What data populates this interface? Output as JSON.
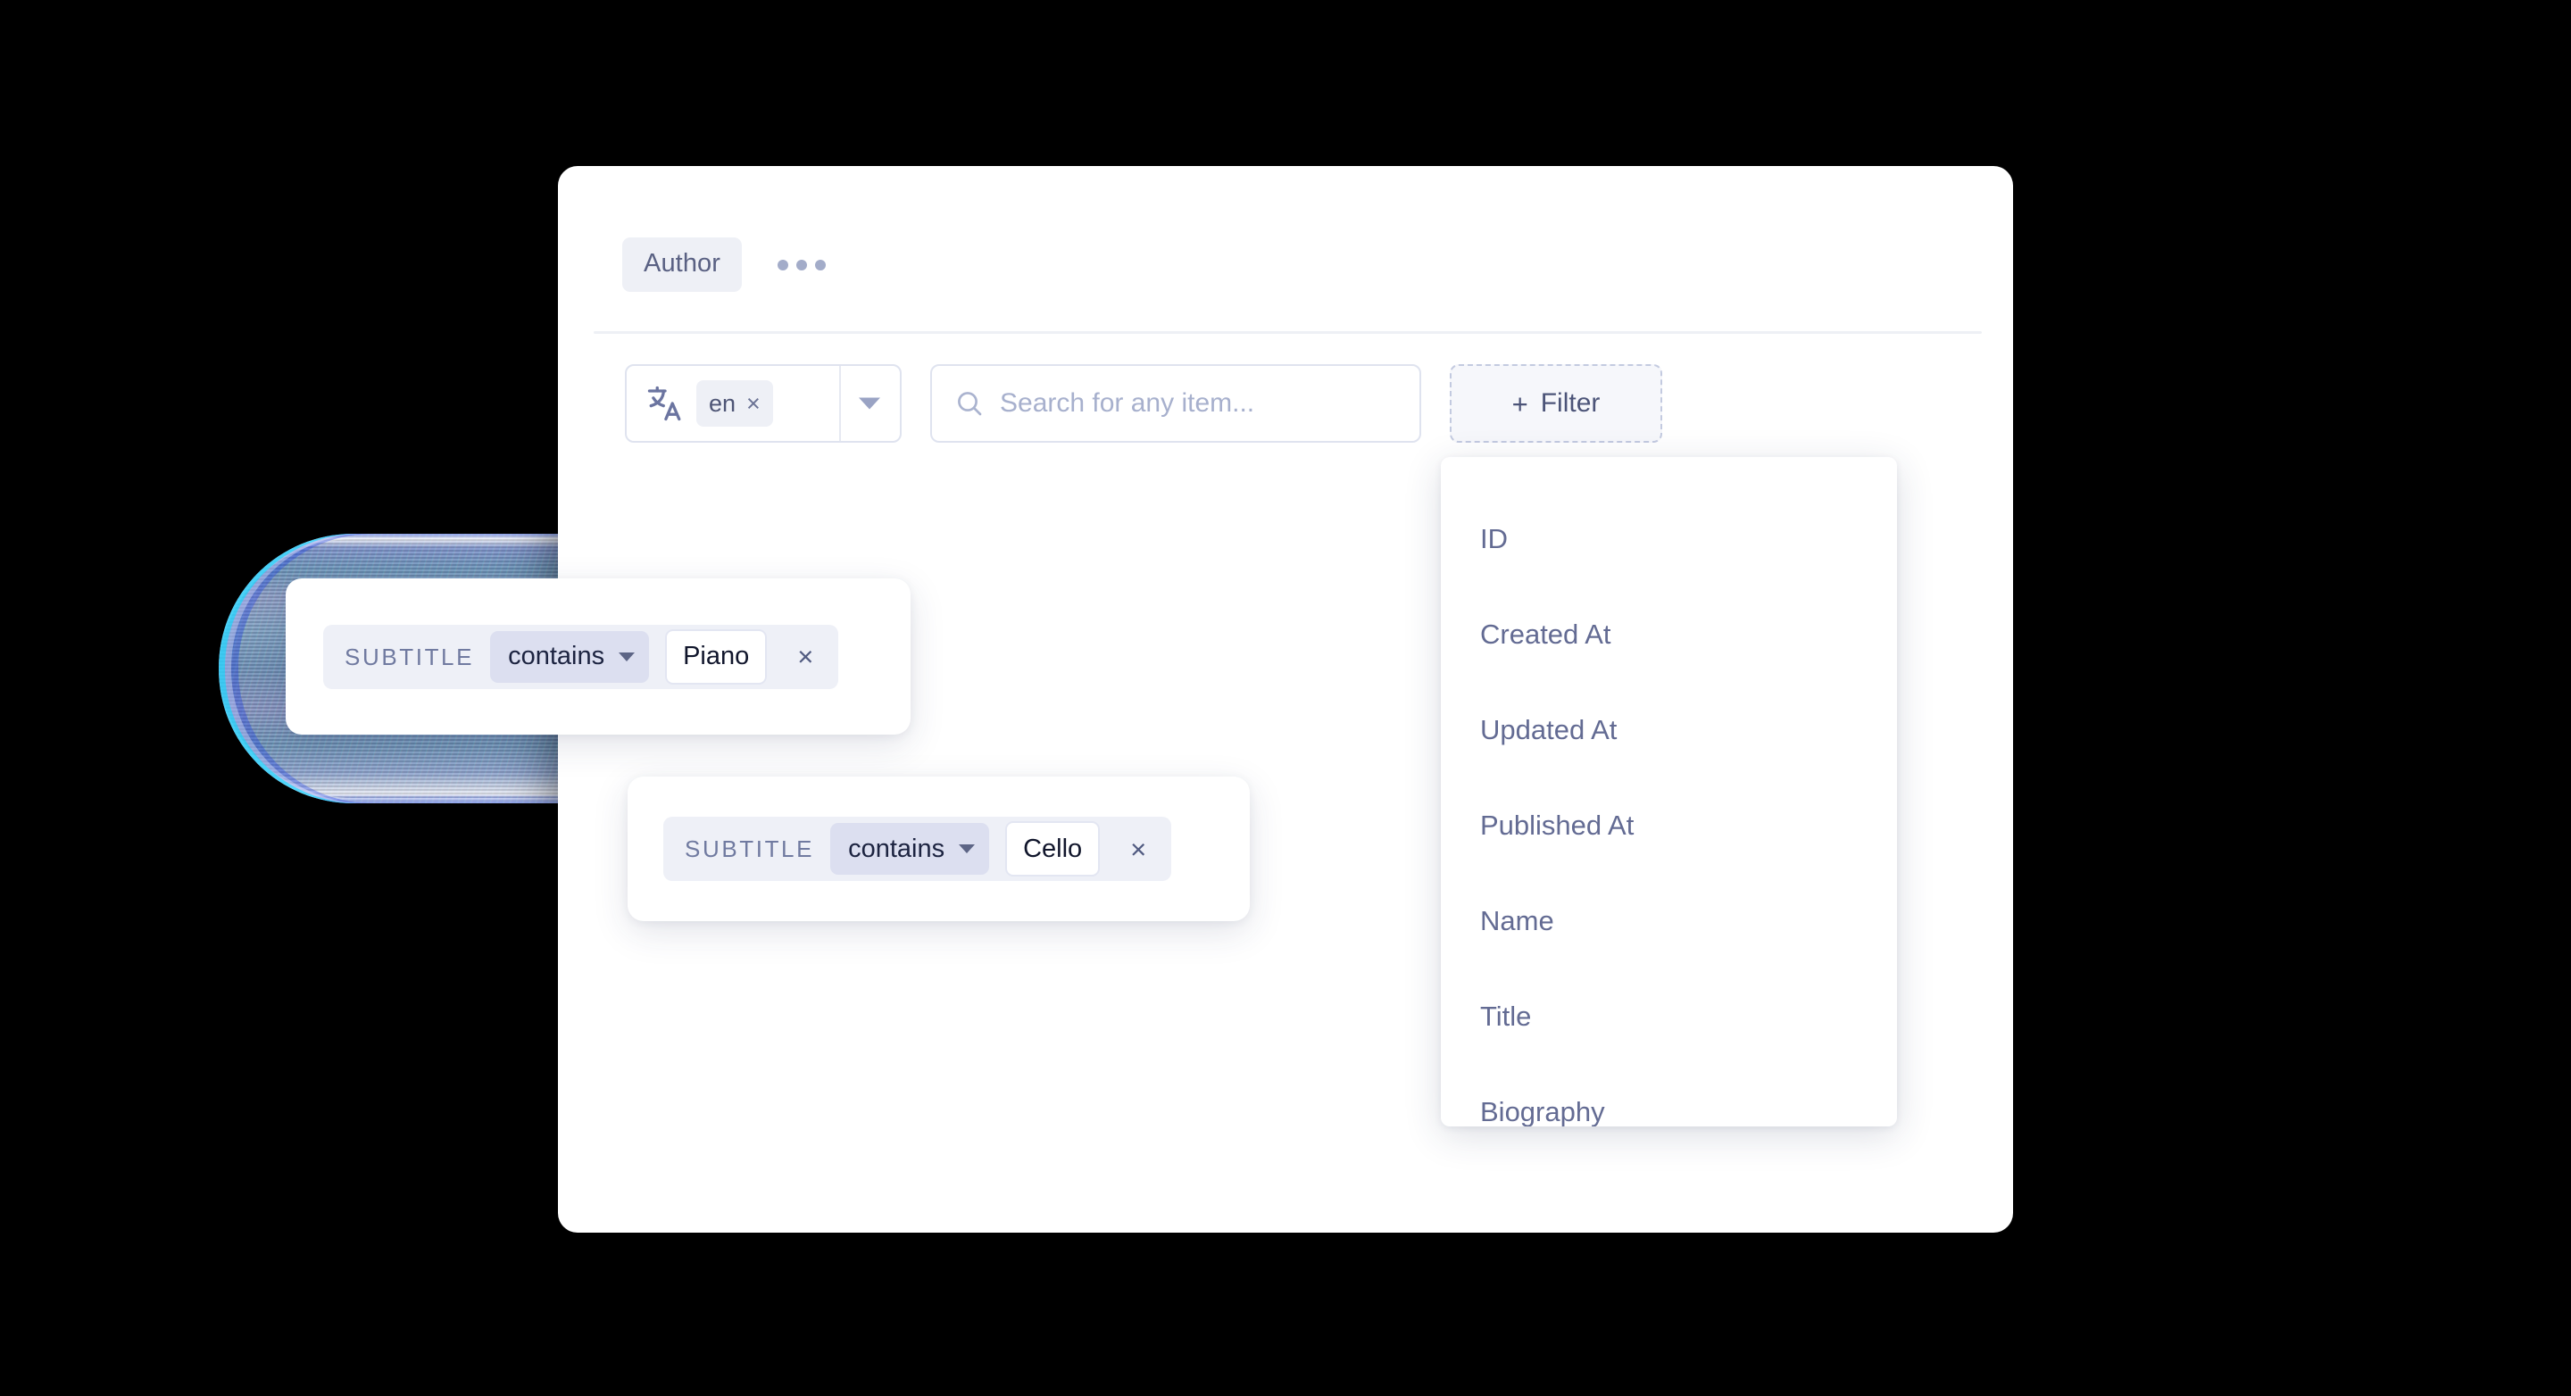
{
  "window": {
    "background_color": "#000000",
    "card_background": "#ffffff"
  },
  "tabs": {
    "active_label": "Author",
    "more_icon": "ellipsis-icon"
  },
  "toolbar": {
    "locale": {
      "icon": "translate-icon",
      "chip_label": "en",
      "chip_remove_glyph": "×",
      "caret_icon": "chevron-down-icon"
    },
    "search": {
      "icon": "search-icon",
      "value": "",
      "placeholder": "Search for any item..."
    },
    "filter_button": {
      "plus_glyph": "+",
      "label": "Filter"
    }
  },
  "field_dropdown": {
    "items": [
      {
        "label": "ID"
      },
      {
        "label": "Created At"
      },
      {
        "label": "Updated At"
      },
      {
        "label": "Published At"
      },
      {
        "label": "Name"
      },
      {
        "label": "Title"
      },
      {
        "label": "Biography"
      }
    ]
  },
  "filter_cards": [
    {
      "field_label": "SUBTITLE",
      "operator": "contains",
      "value": "Piano",
      "remove_glyph": "×"
    },
    {
      "field_label": "SUBTITLE",
      "operator": "contains",
      "value": "Cello",
      "remove_glyph": "×"
    }
  ],
  "colors": {
    "accent_chip_bg": "#eef0f6",
    "operator_bg": "#dcdff0",
    "filter_row_bg": "#eef0f7",
    "text_muted": "#636b93",
    "text_dark": "#10152b",
    "border": "#dfe3ef"
  }
}
